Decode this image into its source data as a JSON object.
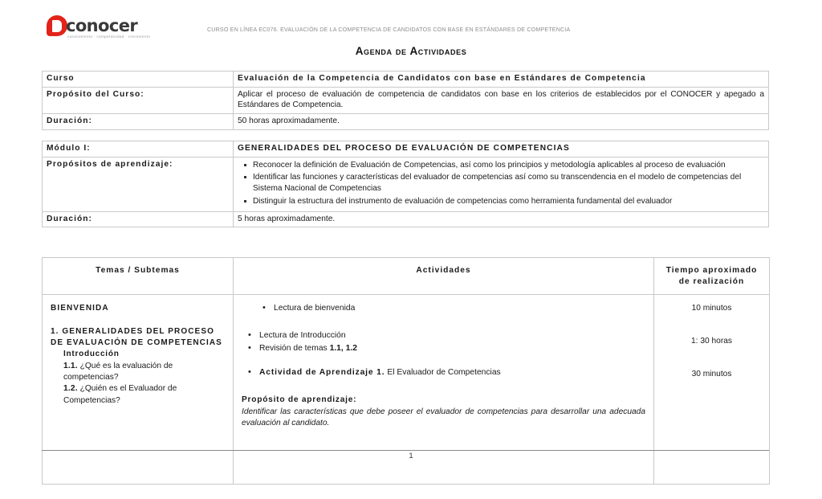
{
  "header": {
    "logo_word": "conocer",
    "logo_tagline": "conocimiento · competitividad · crecimiento",
    "course_strip": "CURSO EN LÍNEA EC076. EVALUACIÓN DE LA COMPETENCIA DE CANDIDATOS CON BASE EN ESTÁNDARES DE COMPETENCIA",
    "doc_title": "Agenda de Actividades",
    "brand_color": "#e2231a"
  },
  "course_table": {
    "curso_label": "Curso",
    "curso_value": "Evaluación de la Competencia de Candidatos con base en Estándares de Competencia",
    "proposito_label": "Propósito del Curso:",
    "proposito_value": "Aplicar el proceso de evaluación de competencia de candidatos con base en los criterios de establecidos por el CONOCER y apegado a Estándares de Competencia.",
    "duracion_label": "Duración:",
    "duracion_value": "50 horas aproximadamente."
  },
  "module_table": {
    "modulo_label": "Módulo I:",
    "modulo_value": "GENERALIDADES DEL PROCESO DE EVALUACIÓN DE COMPETENCIAS",
    "propositos_label": "Propósitos de aprendizaje:",
    "propositos_items": [
      "Reconocer la definición de Evaluación de Competencias, así como los principios y metodología aplicables al proceso de evaluación",
      "Identificar las funciones y características del evaluador de competencias así como su transcendencia en el modelo de competencias del Sistema Nacional de Competencias",
      "Distinguir la estructura del instrumento de evaluación de competencias como herramienta fundamental del evaluador"
    ],
    "duracion_label": "Duración:",
    "duracion_value": "5 horas aproximadamente."
  },
  "agenda_table": {
    "headers": {
      "temas": "Temas / Subtemas",
      "actividades": "Actividades",
      "tiempo_line1": "Tiempo aproximado",
      "tiempo_line2": "de realización"
    },
    "temas": {
      "bienvenida": "BIENVENIDA",
      "unidad_titulo": "1. GENERALIDADES DEL PROCESO DE EVALUACIÓN DE COMPETENCIAS",
      "introduccion": "Introducción",
      "sub_1_1_num": "1.1.",
      "sub_1_1_text": " ¿Qué es la evaluación de competencias?",
      "sub_1_2_num": "1.2.",
      "sub_1_2_text": " ¿Quién es el Evaluador de Competencias?"
    },
    "actividades": {
      "grupo1": [
        "Lectura de bienvenida"
      ],
      "grupo2": [
        "Lectura de Introducción"
      ],
      "grupo2_b_pre": "Revisión de temas ",
      "grupo2_b_bold": "1.1, 1.2",
      "grupo3_bold": "Actividad de Aprendizaje 1.",
      "grupo3_rest": " El Evaluador de Competencias",
      "proposito_title": "Propósito de aprendizaje:",
      "proposito_body": "Identificar las características que debe poseer el evaluador de competencias para desarrollar una adecuada evaluación al candidato."
    },
    "tiempos": [
      "10 minutos",
      "1: 30 horas",
      "30 minutos"
    ]
  },
  "footer": {
    "page_number": "1"
  }
}
